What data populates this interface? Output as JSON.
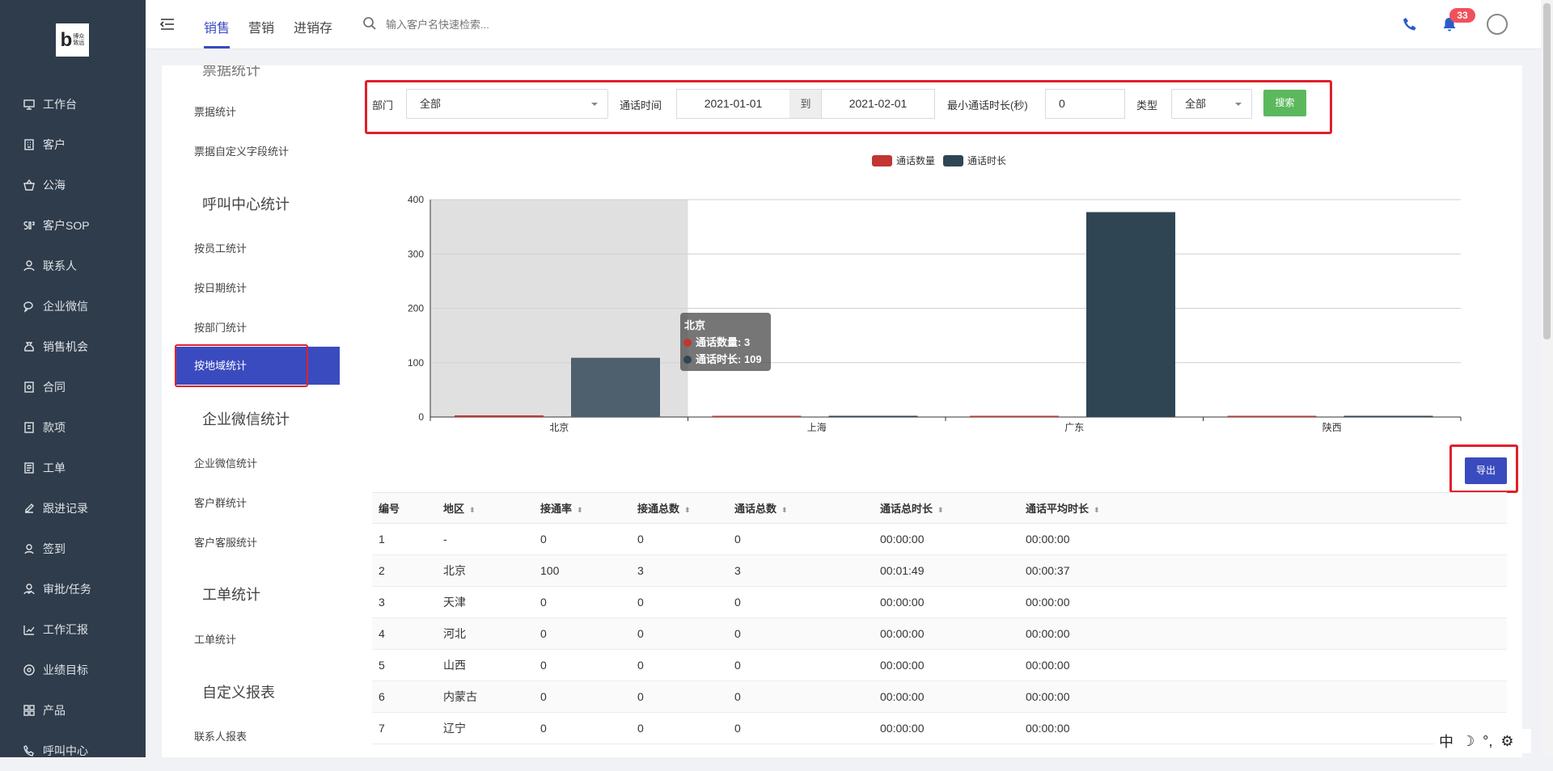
{
  "logo": {
    "brand": "博众",
    "sub": "致远"
  },
  "sidebar": {
    "items": [
      {
        "label": "工作台",
        "icon": "desktop-icon"
      },
      {
        "label": "客户",
        "icon": "building-icon"
      },
      {
        "label": "公海",
        "icon": "basket-icon"
      },
      {
        "label": "客户SOP",
        "icon": "sop-icon"
      },
      {
        "label": "联系人",
        "icon": "contact-icon"
      },
      {
        "label": "企业微信",
        "icon": "wechat-icon"
      },
      {
        "label": "销售机会",
        "icon": "money-bag-icon"
      },
      {
        "label": "合同",
        "icon": "contract-icon"
      },
      {
        "label": "款项",
        "icon": "payment-icon"
      },
      {
        "label": "工单",
        "icon": "ticket-icon"
      },
      {
        "label": "跟进记录",
        "icon": "edit-icon"
      },
      {
        "label": "签到",
        "icon": "checkin-icon"
      },
      {
        "label": "审批/任务",
        "icon": "approval-icon"
      },
      {
        "label": "工作汇报",
        "icon": "report-icon"
      },
      {
        "label": "业绩目标",
        "icon": "target-icon"
      },
      {
        "label": "产品",
        "icon": "grid-icon"
      },
      {
        "label": "呼叫中心",
        "icon": "phone-icon"
      }
    ]
  },
  "topbar": {
    "tabs": [
      "销售",
      "营销",
      "进销存"
    ],
    "active_tab": "销售",
    "search_placeholder": "输入客户名快速检索...",
    "notification_count": "33"
  },
  "subnav": {
    "partial_top": "票据统计",
    "groups": [
      {
        "title": "呼叫中心统计",
        "items": [
          "按员工统计",
          "按日期统计",
          "按部门统计",
          "按地域统计"
        ]
      },
      {
        "title": "企业微信统计",
        "items": [
          "企业微信统计",
          "客户群统计",
          "客户客服统计"
        ]
      },
      {
        "title": "工单统计",
        "items": [
          "工单统计"
        ]
      },
      {
        "title": "自定义报表",
        "items": [
          "联系人报表"
        ]
      }
    ],
    "top_items": [
      "票据统计",
      "票据自定义字段统计"
    ],
    "active_item": "按地域统计"
  },
  "filters": {
    "dept_label": "部门",
    "dept_value": "全部",
    "time_label": "通话时间",
    "date_from": "2021-01-01",
    "to_label": "到",
    "date_to": "2021-02-01",
    "min_duration_label": "最小通话时长(秒)",
    "min_duration_value": "0",
    "type_label": "类型",
    "type_value": "全部",
    "search_button": "搜索"
  },
  "chart_data": {
    "type": "bar",
    "categories": [
      "北京",
      "上海",
      "广东",
      "陕西"
    ],
    "series": [
      {
        "name": "通话数量",
        "values": [
          3,
          0,
          2,
          0
        ],
        "color": "#c23531"
      },
      {
        "name": "通话时长",
        "values": [
          109,
          0,
          377,
          0
        ],
        "color": "#2f4554"
      }
    ],
    "ylim": [
      0,
      400
    ],
    "yticks": [
      0,
      100,
      200,
      300,
      400
    ],
    "legend_position": "top-center",
    "highlighted_category": "北京",
    "tooltip": {
      "title": "北京",
      "lines": [
        "通话数量: 3",
        "通话时长: 109"
      ]
    }
  },
  "export_button": "导出",
  "table": {
    "columns": [
      "编号",
      "地区",
      "接通率",
      "接通总数",
      "通话总数",
      "通话总时长",
      "通话平均时长"
    ],
    "rows": [
      [
        "1",
        "-",
        "0",
        "0",
        "0",
        "00:00:00",
        "00:00:00"
      ],
      [
        "2",
        "北京",
        "100",
        "3",
        "3",
        "00:01:49",
        "00:00:37"
      ],
      [
        "3",
        "天津",
        "0",
        "0",
        "0",
        "00:00:00",
        "00:00:00"
      ],
      [
        "4",
        "河北",
        "0",
        "0",
        "0",
        "00:00:00",
        "00:00:00"
      ],
      [
        "5",
        "山西",
        "0",
        "0",
        "0",
        "00:00:00",
        "00:00:00"
      ],
      [
        "6",
        "内蒙古",
        "0",
        "0",
        "0",
        "00:00:00",
        "00:00:00"
      ],
      [
        "7",
        "辽宁",
        "0",
        "0",
        "0",
        "00:00:00",
        "00:00:00"
      ]
    ]
  },
  "ime": {
    "lang": "中",
    "moon": "☽",
    "punct": "°,",
    "gear": "⚙"
  }
}
